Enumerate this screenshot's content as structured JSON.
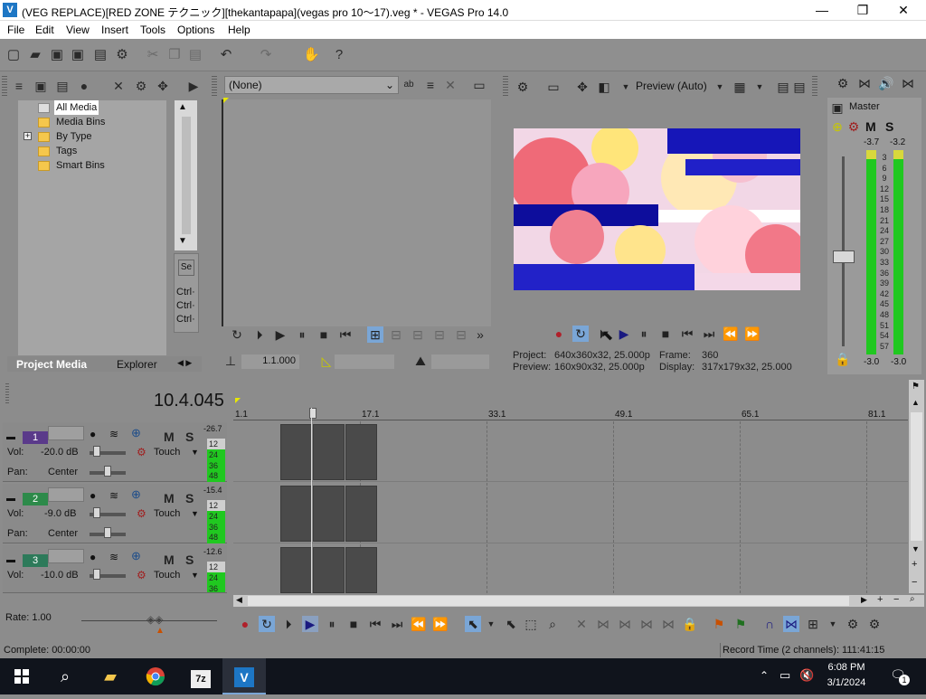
{
  "window": {
    "title": "(VEG REPLACE)[RED ZONE テクニック][thekantapapa](vegas pro 10～17).veg * - VEGAS Pro 14.0",
    "app_icon": "vegas-logo-icon",
    "controls": {
      "minimize": "—",
      "maximize": "❐",
      "close": "✕"
    }
  },
  "menu": [
    "File",
    "Edit",
    "View",
    "Insert",
    "Tools",
    "Options",
    "Help"
  ],
  "toolbar_icons": [
    "new-icon",
    "open-icon",
    "save-icon",
    "save-as-icon",
    "render-icon",
    "properties-icon",
    "cut-icon",
    "copy-icon",
    "paste-icon",
    "undo-icon",
    "redo-icon",
    "normal-edit-icon",
    "help-icon"
  ],
  "project_media": {
    "tree": [
      {
        "label": "All Media",
        "selected": true
      },
      {
        "label": "Media Bins"
      },
      {
        "label": "By Type",
        "expandable": true,
        "expander": "+"
      },
      {
        "label": "Tags"
      },
      {
        "label": "Smart Bins"
      }
    ],
    "tabs": [
      "Project Media",
      "Explorer"
    ],
    "side_labels": [
      "Ctrl·",
      "Ctrl·",
      "Ctrl·"
    ]
  },
  "trimmer": {
    "dropdown_value": "(None)",
    "position": "1.1.000"
  },
  "preview": {
    "quality": "Preview (Auto)",
    "project": "640x360x32, 25.000p",
    "preview": "160x90x32, 25.000p",
    "frame": "360",
    "display": "317x179x32, 25.000",
    "labels": {
      "project": "Project:",
      "preview": "Preview:",
      "frame": "Frame:",
      "display": "Display:"
    }
  },
  "mixer": {
    "master_label": "Master",
    "peak_left": "-3.7",
    "peak_right": "-3.2",
    "bottom_left": "-3.0",
    "bottom_right": "-3.0",
    "ticks": [
      "3",
      "6",
      "9",
      "12",
      "15",
      "18",
      "21",
      "24",
      "27",
      "30",
      "33",
      "36",
      "39",
      "42",
      "45",
      "48",
      "51",
      "54",
      "57"
    ]
  },
  "timeline": {
    "cursor_time": "10.4.045",
    "ruler": [
      "1.1",
      "17.1",
      "33.1",
      "49.1",
      "65.1",
      "81.1"
    ],
    "tracks": [
      {
        "num": "1",
        "vol_label": "Vol:",
        "vol": "-20.0 dB",
        "pan_label": "Pan:",
        "pan": "Center",
        "mode": "Touch",
        "peak": "-26.7",
        "color": "#5a3a8a",
        "m": "M",
        "s": "S",
        "meter": [
          "12",
          "24",
          "36",
          "48"
        ]
      },
      {
        "num": "2",
        "vol_label": "Vol:",
        "vol": "-9.0 dB",
        "pan_label": "Pan:",
        "pan": "Center",
        "mode": "Touch",
        "peak": "-15.4",
        "color": "#2d8a4a",
        "m": "M",
        "s": "S",
        "meter": [
          "12",
          "24",
          "36",
          "48"
        ]
      },
      {
        "num": "3",
        "vol_label": "Vol:",
        "vol": "-10.0 dB",
        "pan_label": "Pan:",
        "pan": "Center",
        "mode": "Touch",
        "peak": "-12.6",
        "color": "#2d7a5a",
        "m": "M",
        "s": "S",
        "meter": [
          "12",
          "24",
          "36"
        ]
      }
    ],
    "rate": "Rate: 1.00"
  },
  "status": {
    "complete": "Complete: 00:00:00",
    "record_time": "Record Time (2 channels): 111:41:15"
  },
  "taskbar": {
    "apps": [
      "windows-start-icon",
      "search-icon",
      "file-explorer-icon",
      "chrome-icon",
      "7zip-icon",
      "vegas-icon"
    ],
    "app_7z_label": "7z",
    "time": "6:08 PM",
    "date": "3/1/2024",
    "notify_count": "1"
  }
}
